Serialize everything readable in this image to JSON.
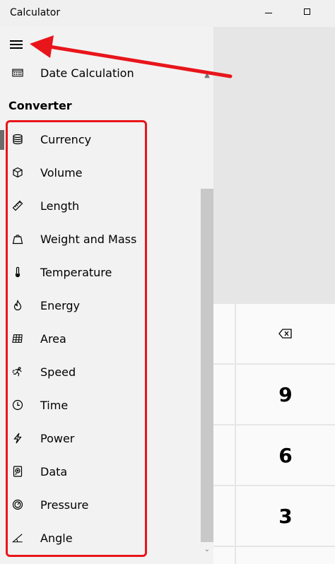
{
  "window": {
    "title": "Calculator"
  },
  "drawer": {
    "top_item": {
      "label": "Date Calculation",
      "icon": "calendar-icon"
    },
    "section_title": "Converter",
    "items": [
      {
        "label": "Currency",
        "icon": "currency-icon"
      },
      {
        "label": "Volume",
        "icon": "cube-icon"
      },
      {
        "label": "Length",
        "icon": "ruler-icon"
      },
      {
        "label": "Weight and Mass",
        "icon": "weight-icon"
      },
      {
        "label": "Temperature",
        "icon": "thermometer-icon"
      },
      {
        "label": "Energy",
        "icon": "flame-icon"
      },
      {
        "label": "Area",
        "icon": "grid-icon"
      },
      {
        "label": "Speed",
        "icon": "runner-icon"
      },
      {
        "label": "Time",
        "icon": "clock-icon"
      },
      {
        "label": "Power",
        "icon": "lightning-icon"
      },
      {
        "label": "Data",
        "icon": "hard-drive-icon"
      },
      {
        "label": "Pressure",
        "icon": "gauge-icon"
      },
      {
        "label": "Angle",
        "icon": "angle-icon"
      }
    ]
  },
  "keypad": {
    "backspace": "⌫",
    "keys": [
      "9",
      "6",
      "3"
    ]
  },
  "annotation": {
    "color": "#e8151b"
  }
}
